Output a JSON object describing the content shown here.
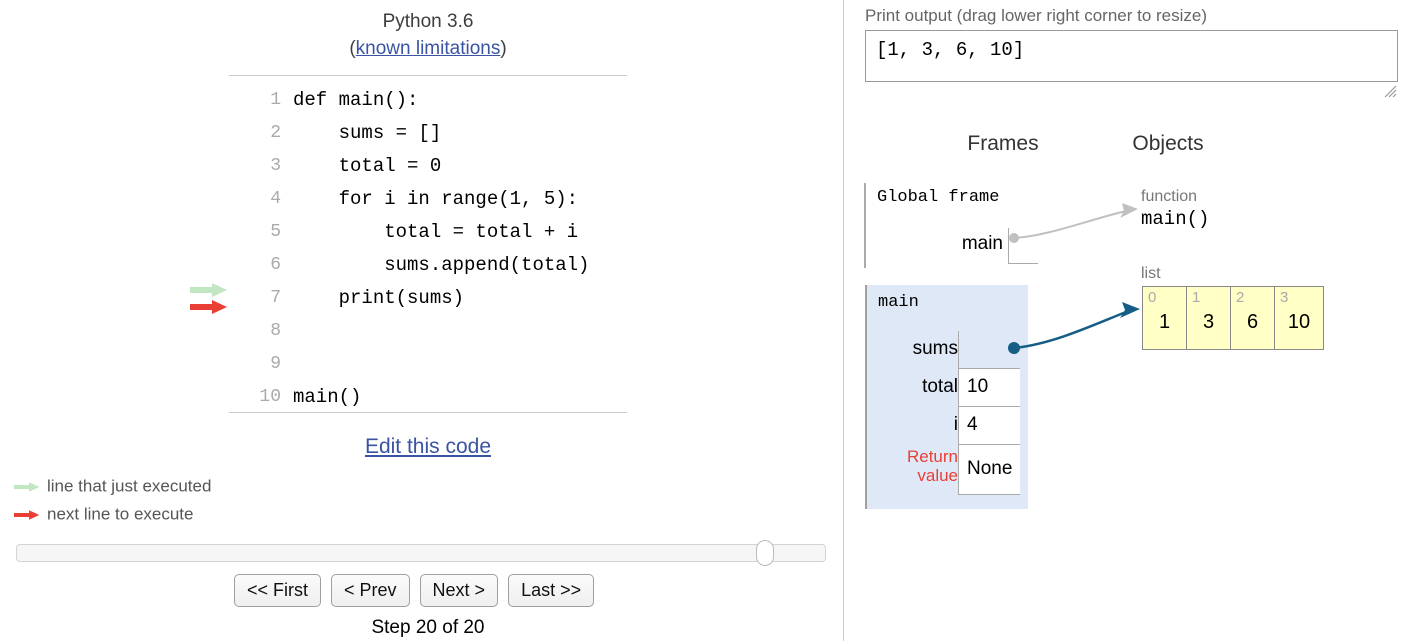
{
  "left": {
    "header": {
      "version": "Python 3.6",
      "open_paren": "(",
      "limitations_link": "known limitations",
      "close_paren": ")"
    },
    "code": {
      "lines": [
        {
          "n": "1",
          "text": "def main():"
        },
        {
          "n": "2",
          "text": "    sums = []"
        },
        {
          "n": "3",
          "text": "    total = 0"
        },
        {
          "n": "4",
          "text": "    for i in range(1, 5):"
        },
        {
          "n": "5",
          "text": "        total = total + i"
        },
        {
          "n": "6",
          "text": "        sums.append(total)"
        },
        {
          "n": "7",
          "text": "    print(sums)"
        },
        {
          "n": "8",
          "text": ""
        },
        {
          "n": "9",
          "text": ""
        },
        {
          "n": "10",
          "text": "main()"
        }
      ],
      "executed_line": 7,
      "next_line": 7
    },
    "edit_link": "Edit this code",
    "legend": [
      {
        "icon": "green-arrow-icon",
        "label": "line that just executed",
        "color": "#c2e5c2"
      },
      {
        "icon": "red-arrow-icon",
        "label": "next line to execute",
        "color": "#e93f34"
      }
    ],
    "nav": {
      "first": "<< First",
      "prev": "< Prev",
      "next": "Next >",
      "last": "Last >>",
      "step_label": "Step 20 of 20",
      "slider_position_percent": 100
    }
  },
  "right": {
    "print_output": {
      "label": "Print output (drag lower right corner to resize)",
      "value": "[1, 3, 6, 10]"
    },
    "headings": {
      "frames": "Frames",
      "objects": "Objects"
    },
    "global_frame": {
      "title": "Global frame",
      "variables": [
        {
          "name": "main",
          "value": "",
          "is_pointer": true
        }
      ]
    },
    "main_frame": {
      "title": "main",
      "variables": [
        {
          "name": "sums",
          "value": "",
          "is_pointer": true
        },
        {
          "name": "total",
          "value": "10",
          "is_pointer": false
        },
        {
          "name": "i",
          "value": "4",
          "is_pointer": false
        },
        {
          "name": "Return value",
          "value": "None",
          "is_pointer": false,
          "is_return": true
        }
      ]
    },
    "objects": [
      {
        "type_label": "function",
        "name": "main()"
      },
      {
        "type_label": "list",
        "elements": [
          {
            "index": "0",
            "value": "1"
          },
          {
            "index": "1",
            "value": "3"
          },
          {
            "index": "2",
            "value": "6"
          },
          {
            "index": "3",
            "value": "10"
          }
        ]
      }
    ],
    "colors": {
      "frame_bg": "#dfe8f6",
      "list_bg": "#ffffc6",
      "pointer_blue": "#175e87",
      "pointer_gray": "#c0c0c0",
      "return_red": "#e93f34"
    }
  }
}
